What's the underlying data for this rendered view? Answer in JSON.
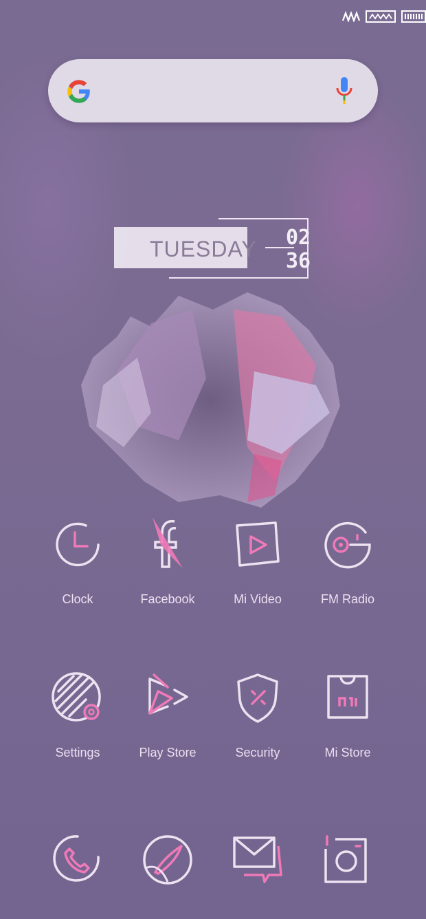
{
  "status_bar": {
    "icons": [
      "signal-wave-icon",
      "network-box-icon",
      "battery-icon"
    ]
  },
  "search": {
    "placeholder": "",
    "logo": "google-g-icon",
    "mic": "microphone-icon"
  },
  "clock_widget": {
    "day": "TUESDAY",
    "hour": "02",
    "minute": "36"
  },
  "apps_row1": [
    {
      "label": "Clock",
      "icon": "clock-icon"
    },
    {
      "label": "Facebook",
      "icon": "facebook-icon"
    },
    {
      "label": "Mi Video",
      "icon": "play-video-icon"
    },
    {
      "label": "FM Radio",
      "icon": "radio-icon"
    }
  ],
  "apps_row2": [
    {
      "label": "Settings",
      "icon": "settings-icon"
    },
    {
      "label": "Play Store",
      "icon": "play-store-icon"
    },
    {
      "label": "Security",
      "icon": "shield-icon"
    },
    {
      "label": "Mi Store",
      "icon": "shopping-bag-icon"
    }
  ],
  "dock": [
    {
      "icon": "phone-icon"
    },
    {
      "icon": "rocket-browser-icon"
    },
    {
      "icon": "message-mail-icon"
    },
    {
      "icon": "camera-icon"
    }
  ],
  "colors": {
    "accent_pink": "#f07ab8",
    "icon_stroke": "#ece2f0",
    "background": "#7a6b92"
  }
}
